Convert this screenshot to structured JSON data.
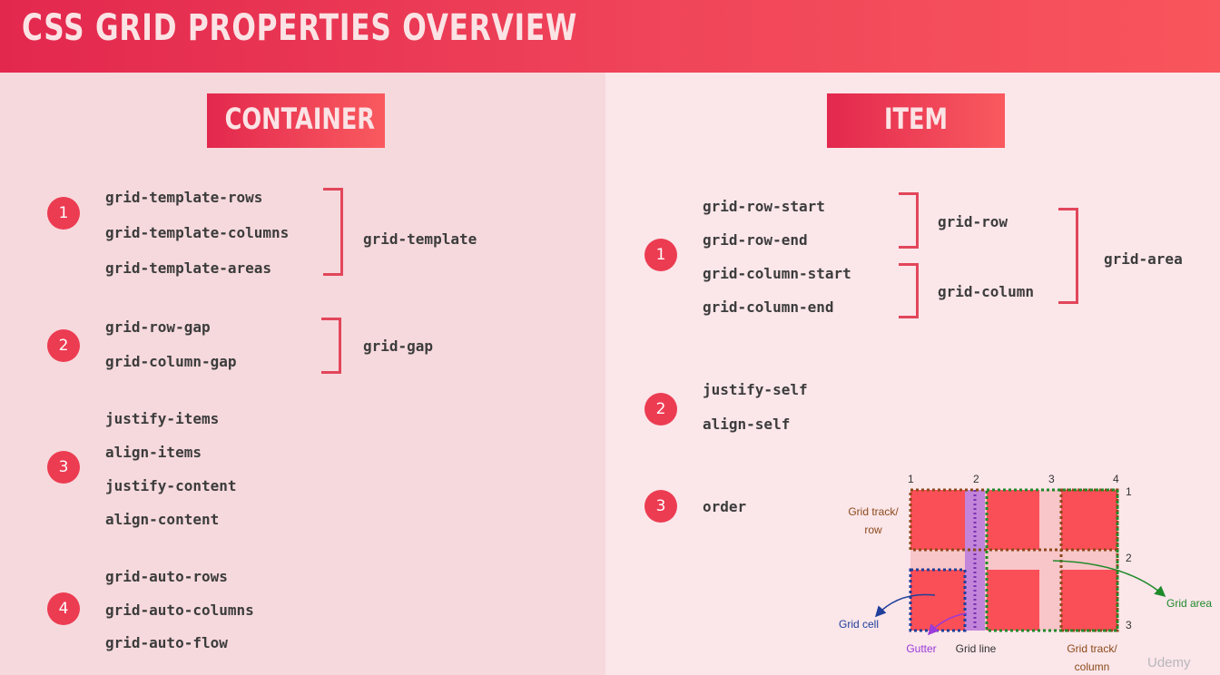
{
  "title": "CSS GRID PROPERTIES OVERVIEW",
  "container": {
    "heading": "CONTAINER",
    "groups": [
      {
        "number": "1",
        "props": [
          "grid-template-rows",
          "grid-template-columns",
          "grid-template-areas"
        ],
        "shorthand": "grid-template"
      },
      {
        "number": "2",
        "props": [
          "grid-row-gap",
          "grid-column-gap"
        ],
        "shorthand": "grid-gap"
      },
      {
        "number": "3",
        "props": [
          "justify-items",
          "align-items",
          "justify-content",
          "align-content"
        ]
      },
      {
        "number": "4",
        "props": [
          "grid-auto-rows",
          "grid-auto-columns",
          "grid-auto-flow"
        ]
      }
    ]
  },
  "item": {
    "heading": "ITEM",
    "groups": [
      {
        "number": "1",
        "props": [
          "grid-row-start",
          "grid-row-end",
          "grid-column-start",
          "grid-column-end"
        ],
        "shorthands": [
          "grid-row",
          "grid-column"
        ],
        "outer_shorthand": "grid-area"
      },
      {
        "number": "2",
        "props": [
          "justify-self",
          "align-self"
        ]
      },
      {
        "number": "3",
        "props": [
          "order"
        ]
      }
    ]
  },
  "diagram": {
    "column_lines": [
      "1",
      "2",
      "3",
      "4"
    ],
    "row_lines": [
      "1",
      "2",
      "3"
    ],
    "labels": {
      "track_row_1": "Grid track/",
      "track_row_2": "row",
      "grid_cell": "Grid cell",
      "gutter": "Gutter",
      "grid_line": "Grid line",
      "track_col_1": "Grid track/",
      "track_col_2": "column",
      "grid_area": "Grid area"
    },
    "colors": {
      "cell": "#fb4f57",
      "gutter": "#c285da",
      "track": "#8b4a1a",
      "area": "#1f8a2a",
      "cell_outline": "#1f3f9a",
      "gutter_arrow": "#9a3ad8"
    }
  },
  "watermark": "Udemy"
}
